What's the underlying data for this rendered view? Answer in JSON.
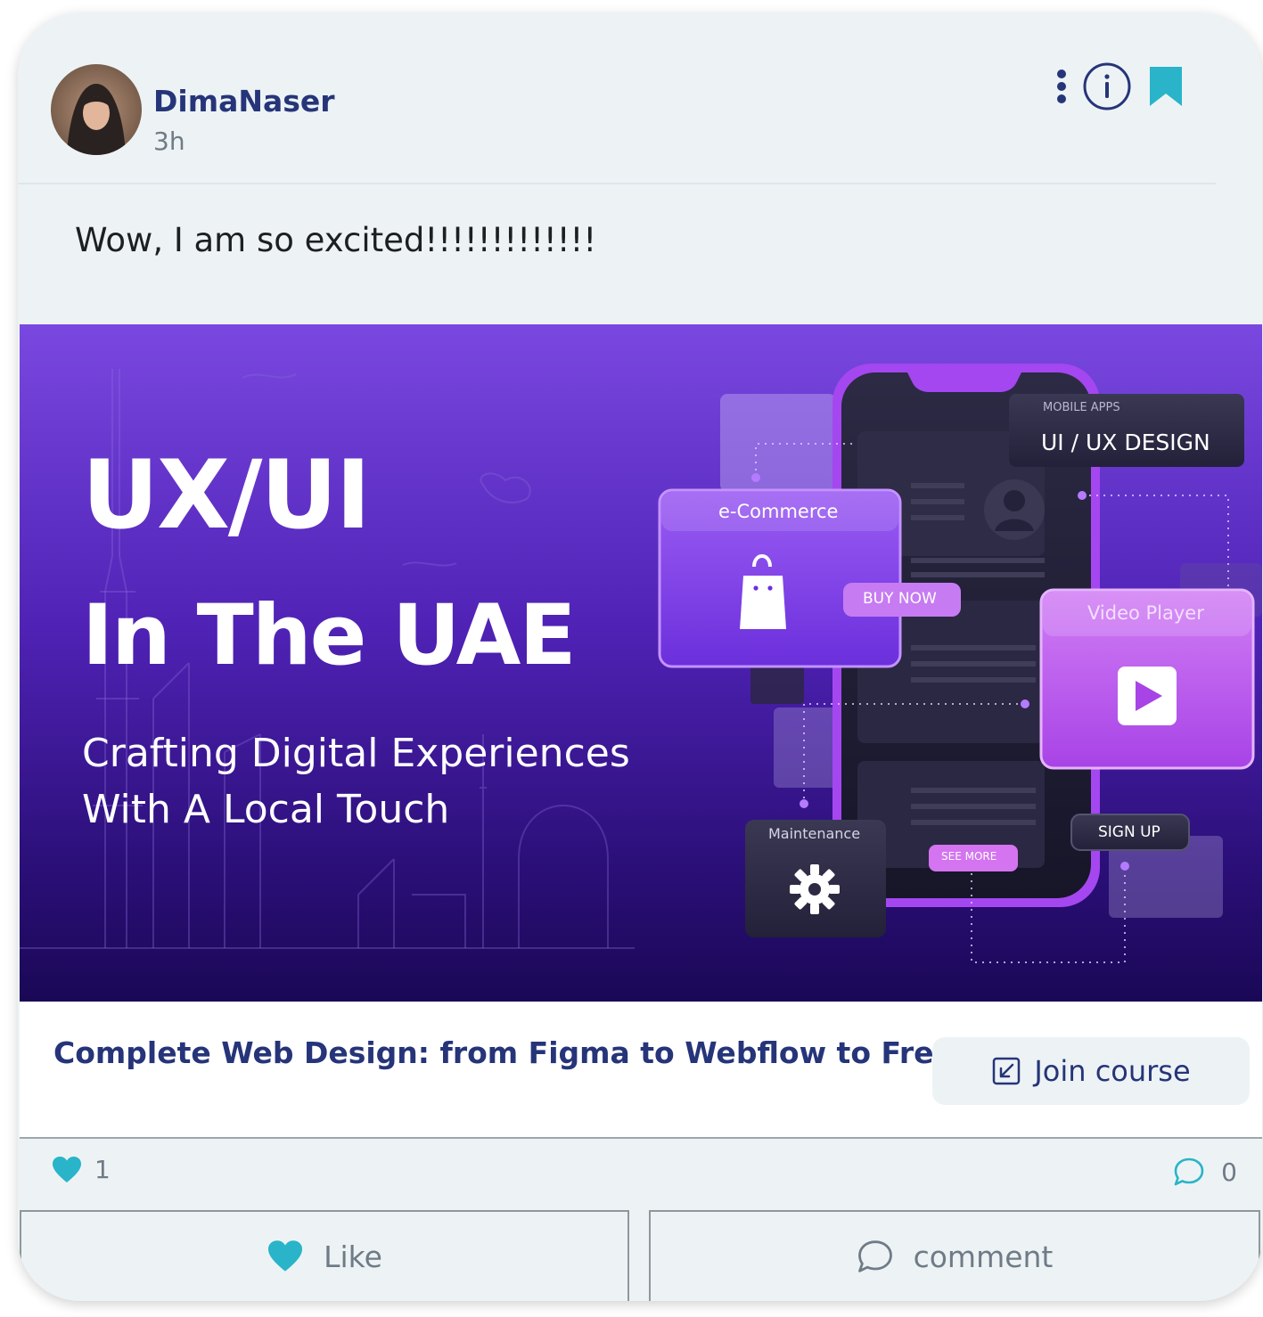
{
  "post": {
    "author": "DimaNaser",
    "time": "3h",
    "text": "Wow, I am so excited!!!!!!!!!!!!!",
    "header_icons": [
      "more-vertical-icon",
      "info-icon",
      "bookmark-icon"
    ]
  },
  "banner": {
    "title": "UX/UI",
    "subtitle": "In The UAE",
    "description": "Crafting Digital Experiences With A Local Touch",
    "cards": {
      "mobile_apps_small": "MOBILE APPS",
      "mobile_apps": "UI / UX DESIGN",
      "ecommerce": "e-Commerce",
      "buy_now": "BUY NOW",
      "video_player": "Video Player",
      "maintenance": "Maintenance",
      "see_more": "SEE MORE",
      "sign_up": "SIGN UP"
    }
  },
  "course": {
    "title": "Complete Web Design: from Figma to Webflow to Freelancing",
    "join_label": "Join course"
  },
  "stats": {
    "likes": "1",
    "comments": "0"
  },
  "actions": {
    "like_label": "Like",
    "comment_label": "comment"
  },
  "colors": {
    "accent_teal": "#29b4c9",
    "navy": "#263579",
    "banner_purple": "#6a2ee0"
  }
}
